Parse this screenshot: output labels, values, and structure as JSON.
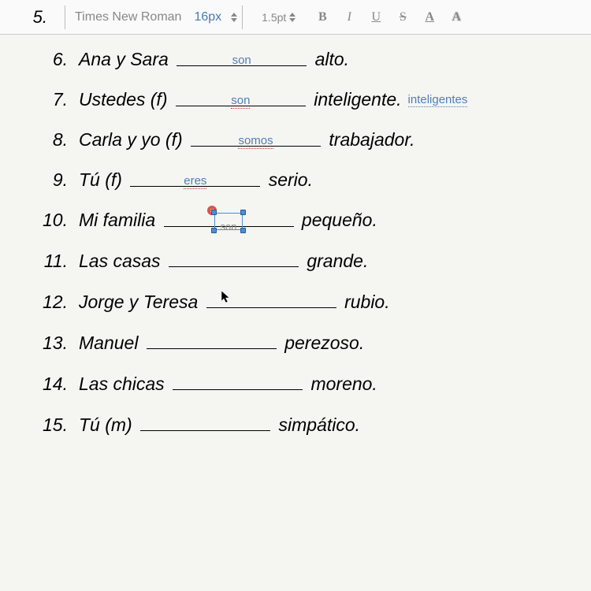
{
  "toolbar": {
    "item_number": "5.",
    "font_name": "Times New Roman",
    "font_size": "16px",
    "line_height": "1.5pt",
    "buttons": {
      "bold": "B",
      "italic": "I",
      "underline": "U",
      "strike": "S",
      "fontcolor": "A",
      "highlight": "A"
    }
  },
  "rows": [
    {
      "num": "6.",
      "subject": "Ana y Sara ",
      "answer": "son",
      "answer_redunder": false,
      "ending": " alto."
    },
    {
      "num": "7.",
      "subject": "Ustedes (f) ",
      "answer": "son",
      "answer_redunder": true,
      "ending": " inteligente.",
      "suggestion": "inteligentes"
    },
    {
      "num": "8.",
      "subject": "Carla y yo (f) ",
      "answer": "somos",
      "answer_redunder": true,
      "ending": " trabajador."
    },
    {
      "num": "9.",
      "subject": "Tú (f) ",
      "answer": "eres",
      "answer_redunder": true,
      "ending": " serio."
    },
    {
      "num": "10.",
      "subject": "Mi familia ",
      "answer_box": "son",
      "ending": " pequeño."
    },
    {
      "num": "11.",
      "subject": "Las casas ",
      "answer": "",
      "ending": " grande."
    },
    {
      "num": "12.",
      "subject": "Jorge y Teresa ",
      "answer": "",
      "ending": " rubio.",
      "cursor_in_blank": true
    },
    {
      "num": "13.",
      "subject": "Manuel ",
      "answer": "",
      "ending": " perezoso."
    },
    {
      "num": "14.",
      "subject": "Las chicas ",
      "answer": "",
      "ending": " moreno."
    },
    {
      "num": "15.",
      "subject": "Tú (m) ",
      "answer": "",
      "ending": " simpático."
    }
  ]
}
